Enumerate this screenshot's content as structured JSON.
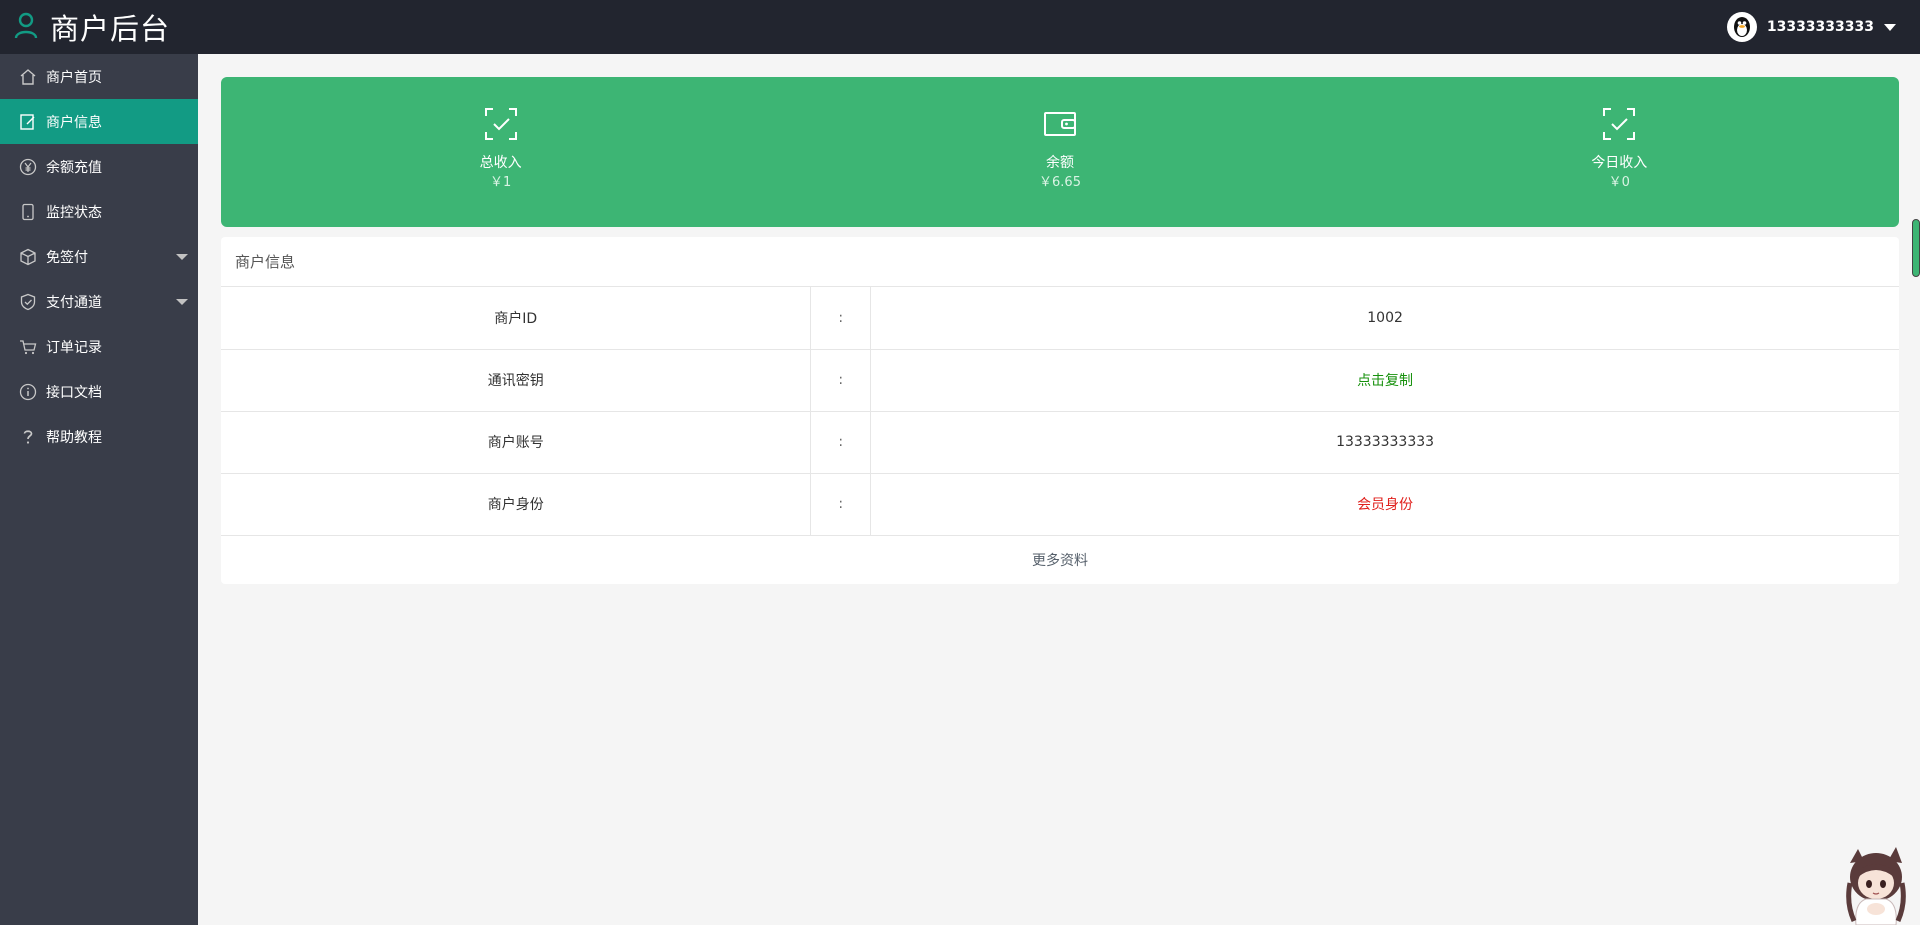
{
  "header": {
    "title": "商户后台",
    "user_name": "13333333333"
  },
  "sidebar": {
    "items": [
      {
        "label": "商户首页",
        "icon": "home-icon"
      },
      {
        "label": "商户信息",
        "icon": "edit-doc-icon",
        "active": true
      },
      {
        "label": "余额充值",
        "icon": "yen-icon"
      },
      {
        "label": "监控状态",
        "icon": "phone-icon"
      },
      {
        "label": "免签付",
        "icon": "box-icon",
        "has_submenu": true
      },
      {
        "label": "支付通道",
        "icon": "shield-check-icon",
        "has_submenu": true
      },
      {
        "label": "订单记录",
        "icon": "cart-icon"
      },
      {
        "label": "接口文档",
        "icon": "info-icon"
      },
      {
        "label": "帮助教程",
        "icon": "question-icon"
      }
    ]
  },
  "stats": [
    {
      "label": "总收入",
      "value": "￥1",
      "icon": "scan-check-icon"
    },
    {
      "label": "余额",
      "value": "￥6.65",
      "icon": "wallet-icon"
    },
    {
      "label": "今日收入",
      "value": "￥0",
      "icon": "scan-check-icon"
    }
  ],
  "info_card": {
    "title": "商户信息",
    "rows": [
      {
        "label": "商户ID",
        "sep": ":",
        "value": "1002"
      },
      {
        "label": "通讯密钥",
        "sep": ":",
        "value": "点击复制"
      },
      {
        "label": "商户账号",
        "sep": ":",
        "value": "13333333333"
      },
      {
        "label": "商户身份",
        "sep": ":",
        "value": "会员身份"
      }
    ],
    "more_label": "更多资料"
  },
  "colors": {
    "header_bg": "#22252f",
    "sidebar_bg": "#393d49",
    "active_item": "#129b84",
    "stats_bg": "#3db574",
    "link_green": "#17910d",
    "red": "#e0201c"
  }
}
